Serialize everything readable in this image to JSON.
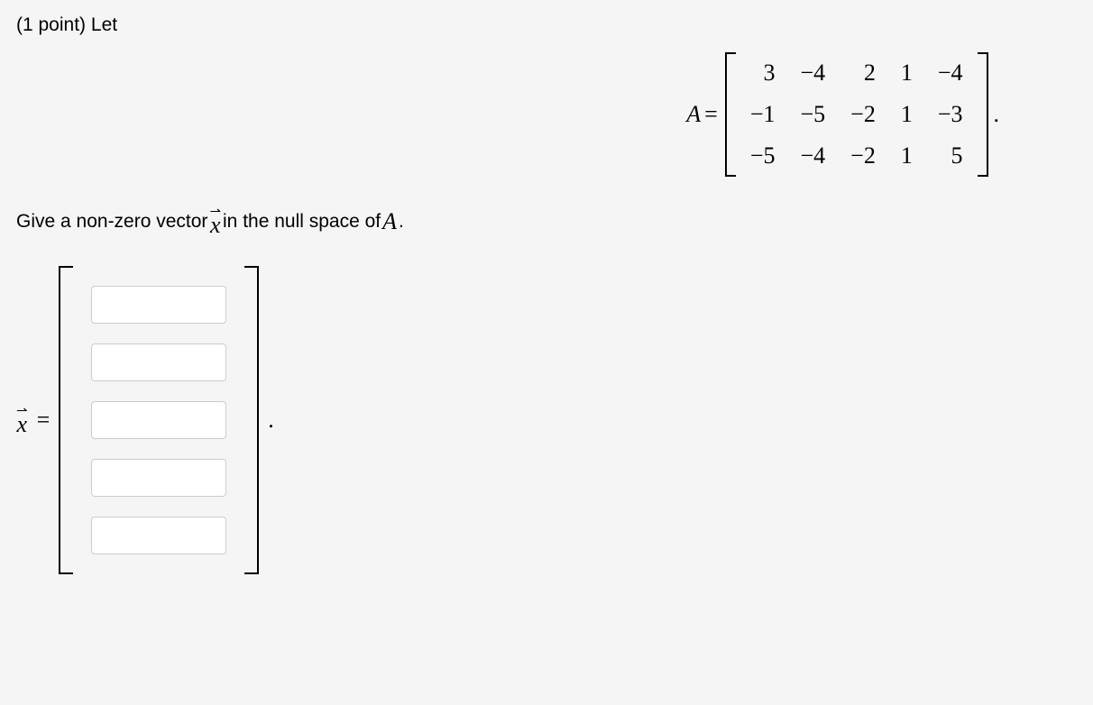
{
  "intro": {
    "points_label": "(1 point)",
    "let_label": "Let"
  },
  "matrix": {
    "label": "A",
    "equals": " = ",
    "rows": [
      [
        "3",
        "−4",
        "2",
        "1",
        "−4"
      ],
      [
        "−1",
        "−5",
        "−2",
        "1",
        "−3"
      ],
      [
        "−5",
        "−4",
        "−2",
        "1",
        "5"
      ]
    ],
    "period": "."
  },
  "prompt": {
    "before_x": "Give a non-zero vector ",
    "after_x_before_A": " in the null space of ",
    "A": "A",
    "end": "."
  },
  "answer": {
    "equals": " = ",
    "period": ".",
    "inputs": [
      "",
      "",
      "",
      "",
      ""
    ]
  }
}
